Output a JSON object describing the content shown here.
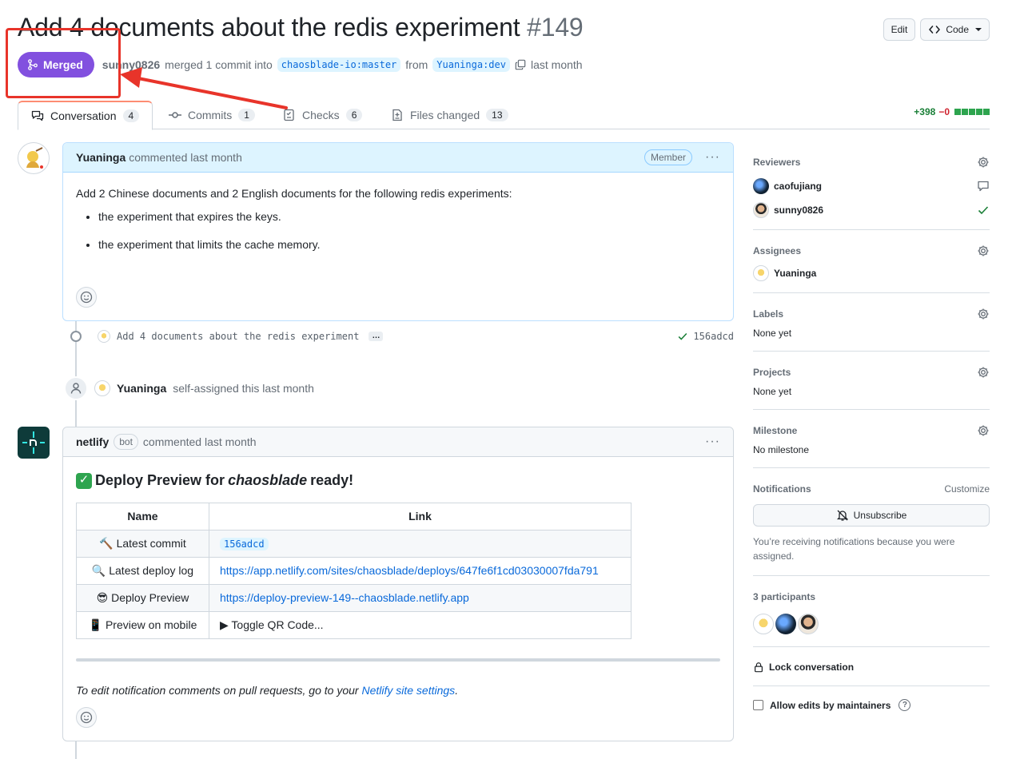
{
  "pr": {
    "title": "Add 4 documents about the redis experiment",
    "number": "#149",
    "state": "Merged",
    "author": "sunny0826",
    "merged_text": "merged 1 commit into",
    "base_branch": "chaosblade-io:master",
    "from_text": "from",
    "head_branch": "Yuaninga:dev",
    "time": "last month"
  },
  "header_actions": {
    "edit": "Edit",
    "code": "Code"
  },
  "tabs": [
    {
      "label": "Conversation",
      "count": "4"
    },
    {
      "label": "Commits",
      "count": "1"
    },
    {
      "label": "Checks",
      "count": "6"
    },
    {
      "label": "Files changed",
      "count": "13"
    }
  ],
  "diffstat": {
    "additions": "+398",
    "deletions": "−0"
  },
  "comment1": {
    "author": "Yuaninga",
    "meta": "commented last month",
    "role": "Member",
    "body": "Add 2 Chinese documents and 2 English documents for the following redis experiments:",
    "items": [
      "the experiment that expires the keys.",
      "the experiment that limits the cache memory."
    ]
  },
  "commit": {
    "message": "Add 4 documents about the redis experiment",
    "ellipsis": "…",
    "sha": "156adcd"
  },
  "event": {
    "actor": "Yuaninga",
    "text": "self-assigned this last month"
  },
  "comment2": {
    "author": "netlify",
    "badge": "bot",
    "meta": "commented last month",
    "heading_pre": "Deploy Preview for",
    "heading_em": "chaosblade",
    "heading_post": "ready!",
    "table": {
      "headers": [
        "Name",
        "Link"
      ],
      "rows": [
        {
          "icon": "🔨",
          "name": "Latest commit",
          "value": "156adcd"
        },
        {
          "icon": "🔍",
          "name": "Latest deploy log",
          "value": "https://app.netlify.com/sites/chaosblade/deploys/647fe6f1cd03030007fda791"
        },
        {
          "icon": "😎",
          "name": "Deploy Preview",
          "value": "https://deploy-preview-149--chaosblade.netlify.app"
        },
        {
          "icon": "📱",
          "name": "Preview on mobile",
          "value": "▶ Toggle QR Code..."
        }
      ]
    },
    "footer_pre": "To edit notification comments on pull requests, go to your",
    "footer_link": "Netlify site settings",
    "footer_post": "."
  },
  "sidebar": {
    "reviewers": {
      "title": "Reviewers",
      "people": [
        "caofujiang",
        "sunny0826"
      ]
    },
    "assignees": {
      "title": "Assignees",
      "people": [
        "Yuaninga"
      ]
    },
    "labels": {
      "title": "Labels",
      "value": "None yet"
    },
    "projects": {
      "title": "Projects",
      "value": "None yet"
    },
    "milestone": {
      "title": "Milestone",
      "value": "No milestone"
    },
    "notifications": {
      "title": "Notifications",
      "customize": "Customize",
      "button": "Unsubscribe",
      "note": "You’re receiving notifications because you were assigned."
    },
    "participants": {
      "title": "3 participants"
    },
    "lock": "Lock conversation",
    "allow_edits": "Allow edits by maintainers"
  },
  "colors": {
    "merged": "#8250df",
    "annotation": "#e8342a",
    "link": "#0969da"
  }
}
